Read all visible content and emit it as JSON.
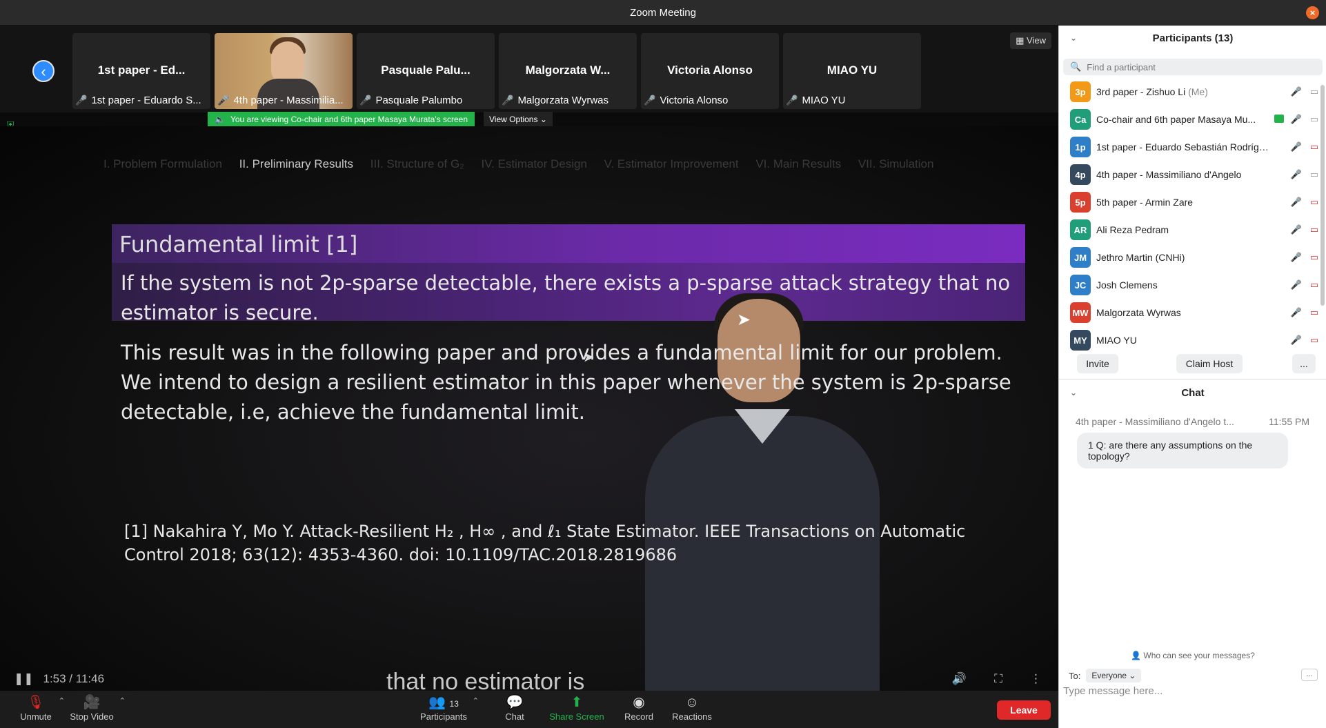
{
  "window": {
    "title": "Zoom Meeting"
  },
  "video_strip": {
    "view_label": "View",
    "tiles": [
      {
        "name_short": "1st paper - Ed...",
        "label": "1st paper - Eduardo S...",
        "has_video": false
      },
      {
        "name_short": "",
        "label": "4th paper - Massimilia...",
        "has_video": true
      },
      {
        "name_short": "Pasquale Palu...",
        "label": "Pasquale Palumbo",
        "has_video": false
      },
      {
        "name_short": "Malgorzata W...",
        "label": "Malgorzata Wyrwas",
        "has_video": false
      },
      {
        "name_short": "Victoria Alonso",
        "label": "Victoria Alonso",
        "has_video": false
      },
      {
        "name_short": "MIAO YU",
        "label": "MIAO YU",
        "has_video": false
      }
    ]
  },
  "share_banner": {
    "text": "You are viewing Co-chair and 6th paper Masaya Murata's screen",
    "view_options": "View Options"
  },
  "slide": {
    "nav": [
      "I. Problem Formulation",
      "II. Preliminary Results",
      "III. Structure of G₂",
      "IV. Estimator Design",
      "V. Estimator Improvement",
      "VI. Main Results",
      "VII. Simulation"
    ],
    "title": "Fundamental limit [1]",
    "block_lines": [
      "If the system is not 2p-sparse detectable, there exists a p-sparse attack strategy that no",
      "estimator is secure."
    ],
    "body_lines": [
      "This result was in the following paper and provides a fundamental limit for our problem.",
      "We intend to design a resilient estimator in this paper whenever the system is 2p-sparse",
      "detectable, i.e, achieve the fundamental limit."
    ],
    "ref_lines": [
      "[1] Nakahira Y, Mo Y. Attack-Resilient H₂ , H∞ , and ℓ₁ State Estimator. IEEE Transactions on Automatic",
      "Control 2018; 63(12): 4353-4360. doi: 10.1109/TAC.2018.2819686"
    ],
    "caption": "that no estimator is",
    "playback_time": "1:53 / 11:46"
  },
  "toolbar": {
    "unmute": "Unmute",
    "stop_video": "Stop Video",
    "participants": "Participants",
    "participant_count": "13",
    "chat": "Chat",
    "share_screen": "Share Screen",
    "record": "Record",
    "reactions": "Reactions",
    "leave": "Leave",
    "share_color": "#23b34a",
    "leave_color": "#e02828"
  },
  "participants_panel": {
    "title": "Participants (13)",
    "search_placeholder": "Find a participant",
    "items": [
      {
        "initials": "3p",
        "color": "#f29a18",
        "name": "3rd paper - Zishuo Li",
        "me": "(Me)",
        "video_off": false,
        "sharing": false
      },
      {
        "initials": "Ca",
        "color": "#1f9e79",
        "name": "Co-chair and 6th paper Masaya Mu...",
        "me": "",
        "video_off": false,
        "sharing": true
      },
      {
        "initials": "1p",
        "color": "#2f7fc8",
        "name": "1st paper - Eduardo Sebastián Rodrígu...",
        "me": "",
        "video_off": true,
        "sharing": false
      },
      {
        "initials": "4p",
        "color": "#34495e",
        "name": "4th paper - Massimiliano d'Angelo",
        "me": "",
        "video_off": false,
        "sharing": false
      },
      {
        "initials": "5p",
        "color": "#d9412e",
        "name": "5th paper - Armin Zare",
        "me": "",
        "video_off": true,
        "sharing": false
      },
      {
        "initials": "AR",
        "color": "#1f9e79",
        "name": "Ali Reza Pedram",
        "me": "",
        "video_off": true,
        "sharing": false
      },
      {
        "initials": "JM",
        "color": "#2f7fc8",
        "name": "Jethro Martin (CNHi)",
        "me": "",
        "video_off": true,
        "sharing": false
      },
      {
        "initials": "JC",
        "color": "#2f7fc8",
        "name": "Josh Clemens",
        "me": "",
        "video_off": true,
        "sharing": false
      },
      {
        "initials": "MW",
        "color": "#d9412e",
        "name": "Malgorzata Wyrwas",
        "me": "",
        "video_off": true,
        "sharing": false
      },
      {
        "initials": "MY",
        "color": "#34495e",
        "name": "MIAO YU",
        "me": "",
        "video_off": true,
        "sharing": false
      }
    ],
    "invite": "Invite",
    "claim_host": "Claim Host",
    "more": "..."
  },
  "chat_panel": {
    "title": "Chat",
    "messages": [
      {
        "sender": "4th paper - Massimiliano d'Angelo t...",
        "time": "11:55 PM",
        "text": "1 Q: are there any assumptions on the topology?"
      }
    ],
    "who_can_see": "Who can see your messages?",
    "to_label": "To:",
    "to_value": "Everyone",
    "more": "...",
    "input_placeholder": "Type message here..."
  }
}
